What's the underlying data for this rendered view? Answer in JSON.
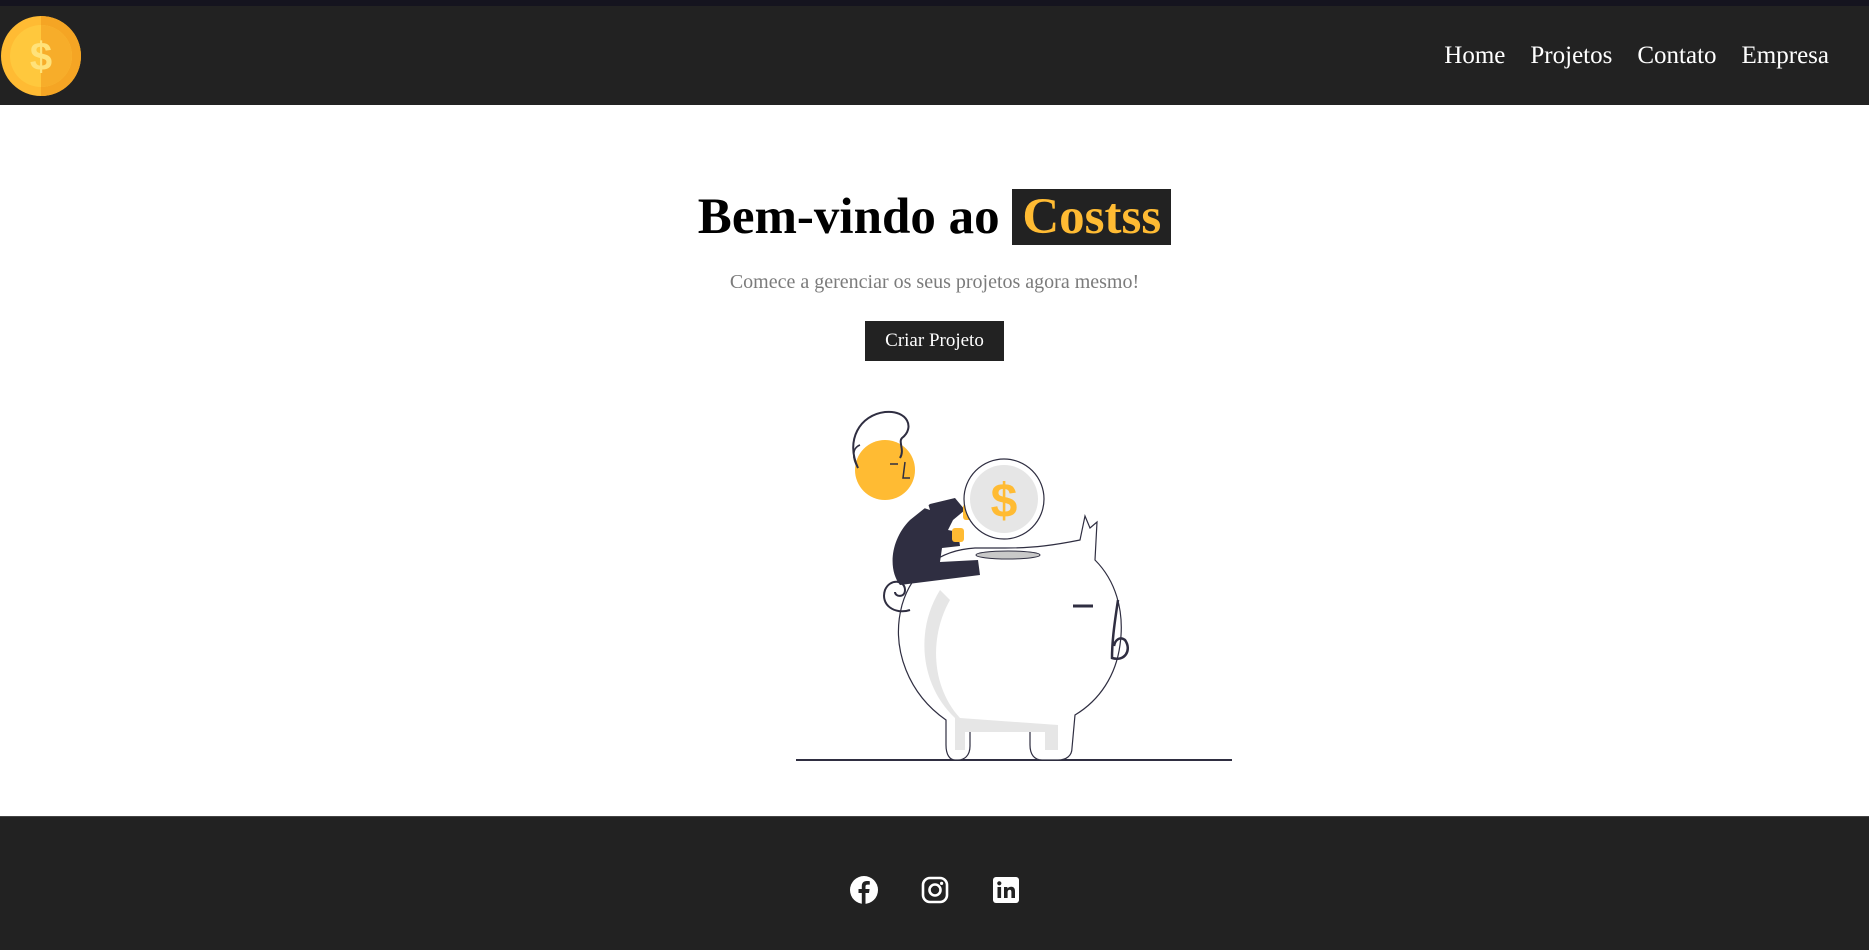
{
  "colors": {
    "accent": "#ffbb33",
    "dark": "#222222",
    "text_muted": "#7b7b7b"
  },
  "navbar": {
    "logo_icon": "dollar-coin-icon",
    "links": [
      {
        "label": "Home"
      },
      {
        "label": "Projetos"
      },
      {
        "label": "Contato"
      },
      {
        "label": "Empresa"
      }
    ]
  },
  "hero": {
    "title_prefix": "Bem-vindo ao",
    "brand": "Costss",
    "subtitle": "Comece a gerenciar os seus projetos agora mesmo!",
    "cta_label": "Criar Projeto",
    "illustration": "piggy-bank-savings-illustration"
  },
  "footer": {
    "social": [
      {
        "icon": "facebook-icon"
      },
      {
        "icon": "instagram-icon"
      },
      {
        "icon": "linkedin-icon"
      }
    ]
  }
}
